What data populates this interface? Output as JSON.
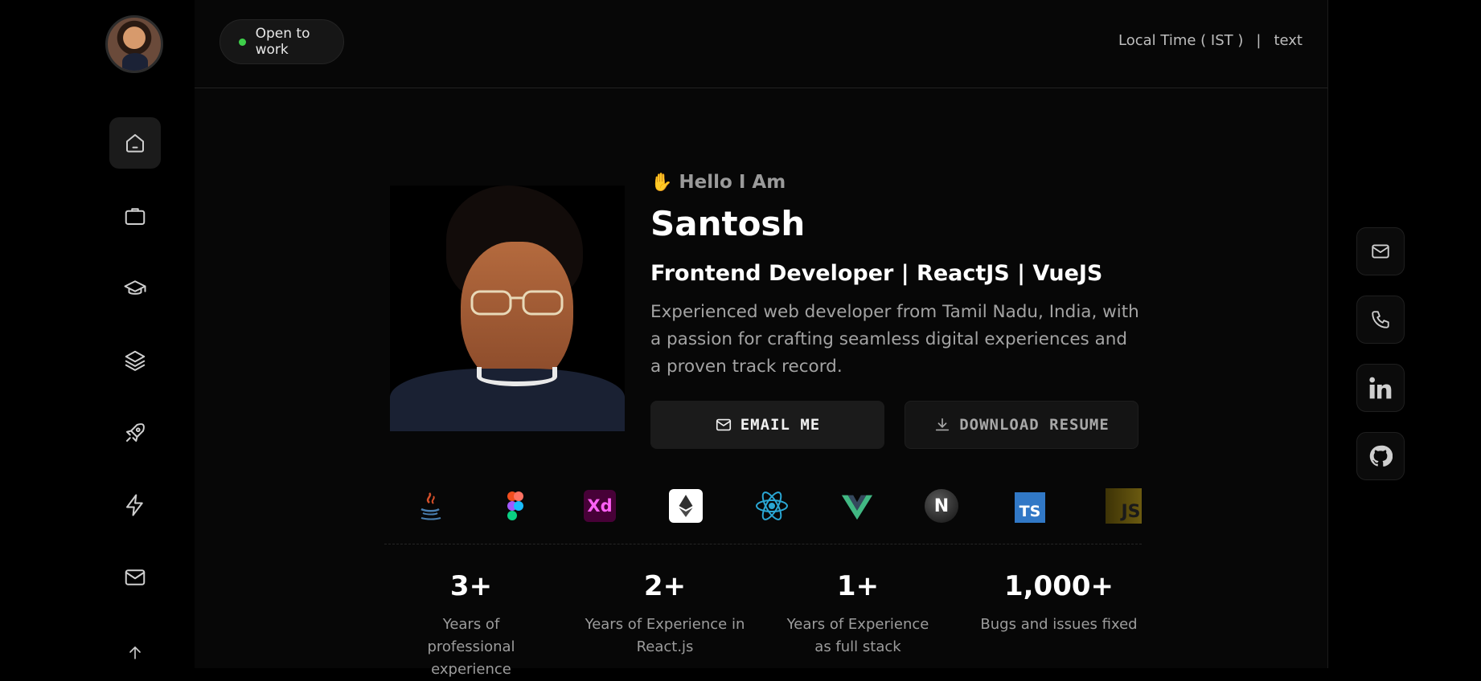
{
  "status": {
    "label": "Open to work",
    "color": "#3ecf4a"
  },
  "header": {
    "local_time_label": "Local Time ( IST )",
    "separator": "|",
    "time_value": "text"
  },
  "sidebar": {
    "items": [
      {
        "icon": "home-icon",
        "active": true
      },
      {
        "icon": "briefcase-icon",
        "active": false
      },
      {
        "icon": "graduation-cap-icon",
        "active": false
      },
      {
        "icon": "layers-icon",
        "active": false
      },
      {
        "icon": "rocket-icon",
        "active": false
      },
      {
        "icon": "lightning-icon",
        "active": false
      },
      {
        "icon": "mail-icon",
        "active": false
      },
      {
        "icon": "arrow-up-icon",
        "active": false
      }
    ]
  },
  "hero": {
    "greeting": "Hello I Am",
    "greeting_icon": "✋",
    "name": "Santosh",
    "role": "Frontend Developer | ReactJS | VueJS",
    "bio": "Experienced web developer from Tamil Nadu, India, with a passion for crafting seamless digital experiences and a proven track record.",
    "email_button": "EMAIL ME",
    "resume_button": "DOWNLOAD RESUME"
  },
  "tech_stack": [
    {
      "name": "java-icon"
    },
    {
      "name": "figma-icon"
    },
    {
      "name": "adobe-xd-icon",
      "text": "Xd"
    },
    {
      "name": "ethereum-icon"
    },
    {
      "name": "react-icon"
    },
    {
      "name": "vue-icon"
    },
    {
      "name": "nextjs-icon",
      "text": "N"
    },
    {
      "name": "typescript-icon",
      "text": "TS"
    },
    {
      "name": "javascript-icon",
      "text": "JS"
    }
  ],
  "stats": [
    {
      "value": "3+",
      "label": "Years of professional experience"
    },
    {
      "value": "2+",
      "label": "Years of Experience in React.js"
    },
    {
      "value": "1+",
      "label": "Years of Experience as full stack"
    },
    {
      "value": "1,000+",
      "label": "Bugs and issues fixed"
    }
  ],
  "socials": [
    {
      "icon": "mail-icon"
    },
    {
      "icon": "phone-icon"
    },
    {
      "icon": "linkedin-icon"
    },
    {
      "icon": "github-icon"
    }
  ]
}
